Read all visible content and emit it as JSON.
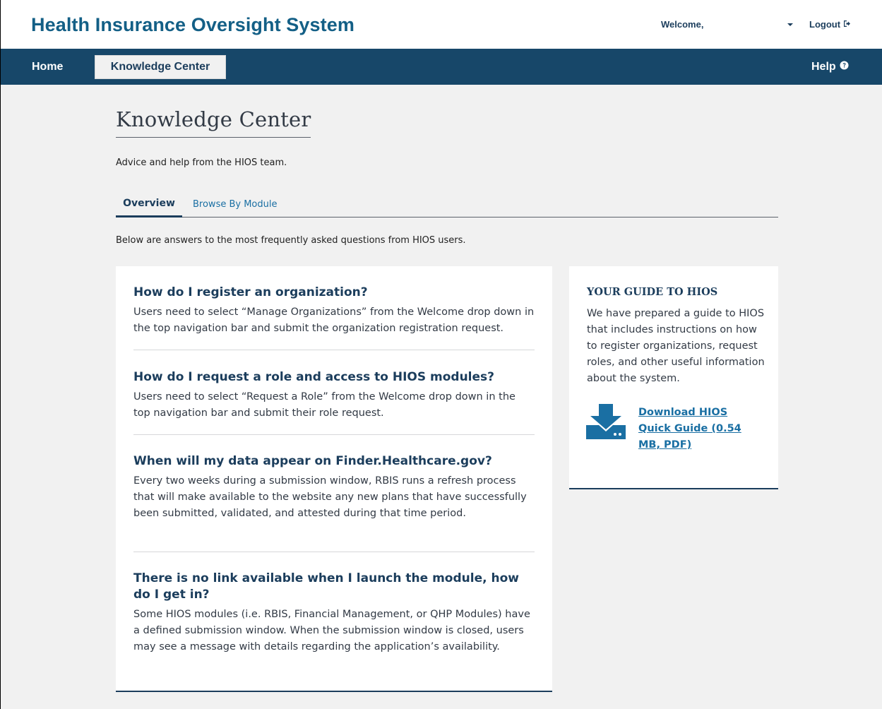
{
  "header": {
    "app_title": "Health Insurance Oversight System",
    "welcome_label": "Welcome,",
    "logout_label": "Logout"
  },
  "nav": {
    "home_label": "Home",
    "knowledge_center_label": "Knowledge Center",
    "help_label": "Help"
  },
  "page": {
    "title": "Knowledge Center",
    "subtitle": "Advice and help from the HIOS team.",
    "tabs": [
      {
        "label": "Overview",
        "active": true
      },
      {
        "label": "Browse By Module",
        "active": false
      }
    ],
    "intro": "Below are answers to the most frequently asked questions from HIOS users."
  },
  "faqs": [
    {
      "question": "How do I register an organization?",
      "answer": "Users need to select “Manage Organizations” from the Welcome drop down in the top navigation bar and submit the organization registration request."
    },
    {
      "question": "How do I request a role and access to HIOS modules?",
      "answer": "Users need to select “Request a Role” from the Welcome drop down in the top navigation bar and submit their role request."
    },
    {
      "question": "When will my data appear on Finder.Healthcare.gov?",
      "answer": "Every two weeks during a submission window, RBIS runs a refresh process that will make available to the website any new plans that have successfully been submitted, validated, and attested during that time period."
    },
    {
      "question": "There is no link available when I launch the module, how do I get in?",
      "answer": "Some HIOS modules (i.e. RBIS, Financial Management, or QHP Modules) have a defined submission window. When the submission window is closed, users may see a message with details regarding the application’s availability."
    }
  ],
  "guide": {
    "title": "YOUR GUIDE TO HIOS",
    "text": "We have prepared a guide to HIOS that includes instructions on how to register organizations, request roles, and other useful information about the system.",
    "download_label": "Download HIOS Quick Guide (0.54 MB, PDF)"
  },
  "colors": {
    "brand_blue": "#135f86",
    "nav_bg": "#174769",
    "heading_navy": "#1b3d5c",
    "link_blue": "#1a6fa3",
    "page_bg": "#f1f1f1"
  }
}
